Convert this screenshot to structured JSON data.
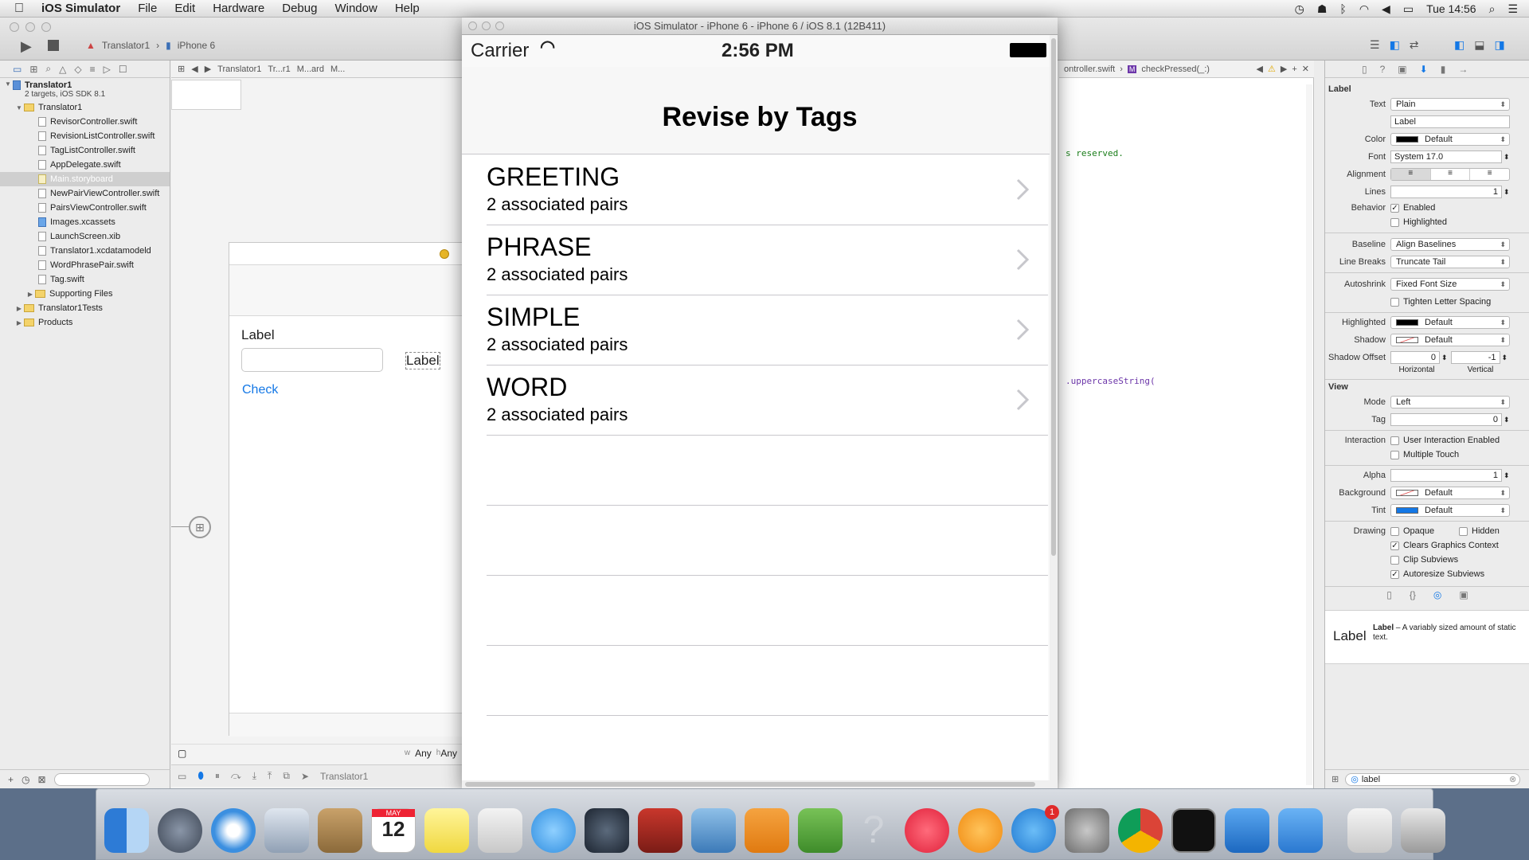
{
  "menubar": {
    "app": "iOS Simulator",
    "items": [
      "File",
      "Edit",
      "Hardware",
      "Debug",
      "Window",
      "Help"
    ],
    "clock": "Tue 14:56"
  },
  "xcode": {
    "breadcrumb_project": "Translator1",
    "breadcrumb_device": "iPhone 6",
    "jumpbar": [
      "Translator1",
      "Tr...r1",
      "M...ard",
      "M..."
    ],
    "editor_jumpbar": [
      "ontroller.swift",
      "checkPressed(_:)"
    ],
    "code_fragments": [
      "s reserved.",
      ".uppercaseString("
    ],
    "navigator": {
      "project": "Translator1",
      "project_sub": "2 targets, iOS SDK 8.1",
      "group": "Translator1",
      "files": [
        "RevisorController.swift",
        "RevisionListController.swift",
        "TagListController.swift",
        "AppDelegate.swift",
        "Main.storyboard",
        "NewPairViewController.swift",
        "PairsViewController.swift",
        "Images.xcassets",
        "LaunchScreen.xib",
        "Translator1.xcdatamodeld",
        "WordPhrasePair.swift",
        "Tag.swift"
      ],
      "selected": "Main.storyboard",
      "subgroups": [
        "Supporting Files"
      ],
      "top_groups": [
        "Translator1Tests",
        "Products"
      ]
    },
    "storyboard": {
      "label1": "Label",
      "label2": "Label",
      "check_button": "Check",
      "size_class_w": "Any",
      "size_class_h": "Any",
      "scene_name": "Translator1"
    },
    "inspector": {
      "section_label": "Label",
      "text_label": "Text",
      "text_value": "Plain",
      "text_content": "Label",
      "color_label": "Color",
      "color_value": "Default",
      "font_label": "Font",
      "font_value": "System 17.0",
      "alignment_label": "Alignment",
      "lines_label": "Lines",
      "lines_value": "1",
      "behavior_label": "Behavior",
      "enabled": "Enabled",
      "highlighted_opt": "Highlighted",
      "baseline_label": "Baseline",
      "baseline_value": "Align Baselines",
      "linebreaks_label": "Line Breaks",
      "linebreaks_value": "Truncate Tail",
      "autoshrink_label": "Autoshrink",
      "autoshrink_value": "Fixed Font Size",
      "tighten": "Tighten Letter Spacing",
      "highlighted_label": "Highlighted",
      "highlighted_value": "Default",
      "shadow_label": "Shadow",
      "shadow_value": "Default",
      "shadow_offset_label": "Shadow Offset",
      "shadow_h": "0",
      "shadow_v": "-1",
      "horizontal": "Horizontal",
      "vertical": "Vertical",
      "section_view": "View",
      "mode_label": "Mode",
      "mode_value": "Left",
      "tag_label": "Tag",
      "tag_value": "0",
      "interaction_label": "Interaction",
      "user_interaction": "User Interaction Enabled",
      "multiple_touch": "Multiple Touch",
      "alpha_label": "Alpha",
      "alpha_value": "1",
      "background_label": "Background",
      "background_value": "Default",
      "tint_label": "Tint",
      "tint_value": "Default",
      "drawing_label": "Drawing",
      "opaque": "Opaque",
      "hidden": "Hidden",
      "clears": "Clears Graphics Context",
      "clip": "Clip Subviews",
      "autoresize": "Autoresize Subviews",
      "library_title": "Label",
      "library_name": "Label",
      "library_desc": " – A variably sized amount of static text.",
      "filter_value": "label"
    }
  },
  "simulator": {
    "window_title": "iOS Simulator - iPhone 6 - iPhone 6 / iOS 8.1 (12B411)",
    "carrier": "Carrier",
    "time": "2:56 PM",
    "nav_title": "Revise by Tags",
    "rows": [
      {
        "title": "GREETING",
        "subtitle": "2 associated pairs"
      },
      {
        "title": "PHRASE",
        "subtitle": "2 associated pairs"
      },
      {
        "title": "SIMPLE",
        "subtitle": "2 associated pairs"
      },
      {
        "title": "WORD",
        "subtitle": "2 associated pairs"
      }
    ]
  },
  "dock": {
    "appstore_badge": "1",
    "calendar_month": "MAY",
    "calendar_day": "12"
  },
  "colors": {
    "tint_blue": "#1478e6",
    "desktop": "#5c6f89"
  }
}
